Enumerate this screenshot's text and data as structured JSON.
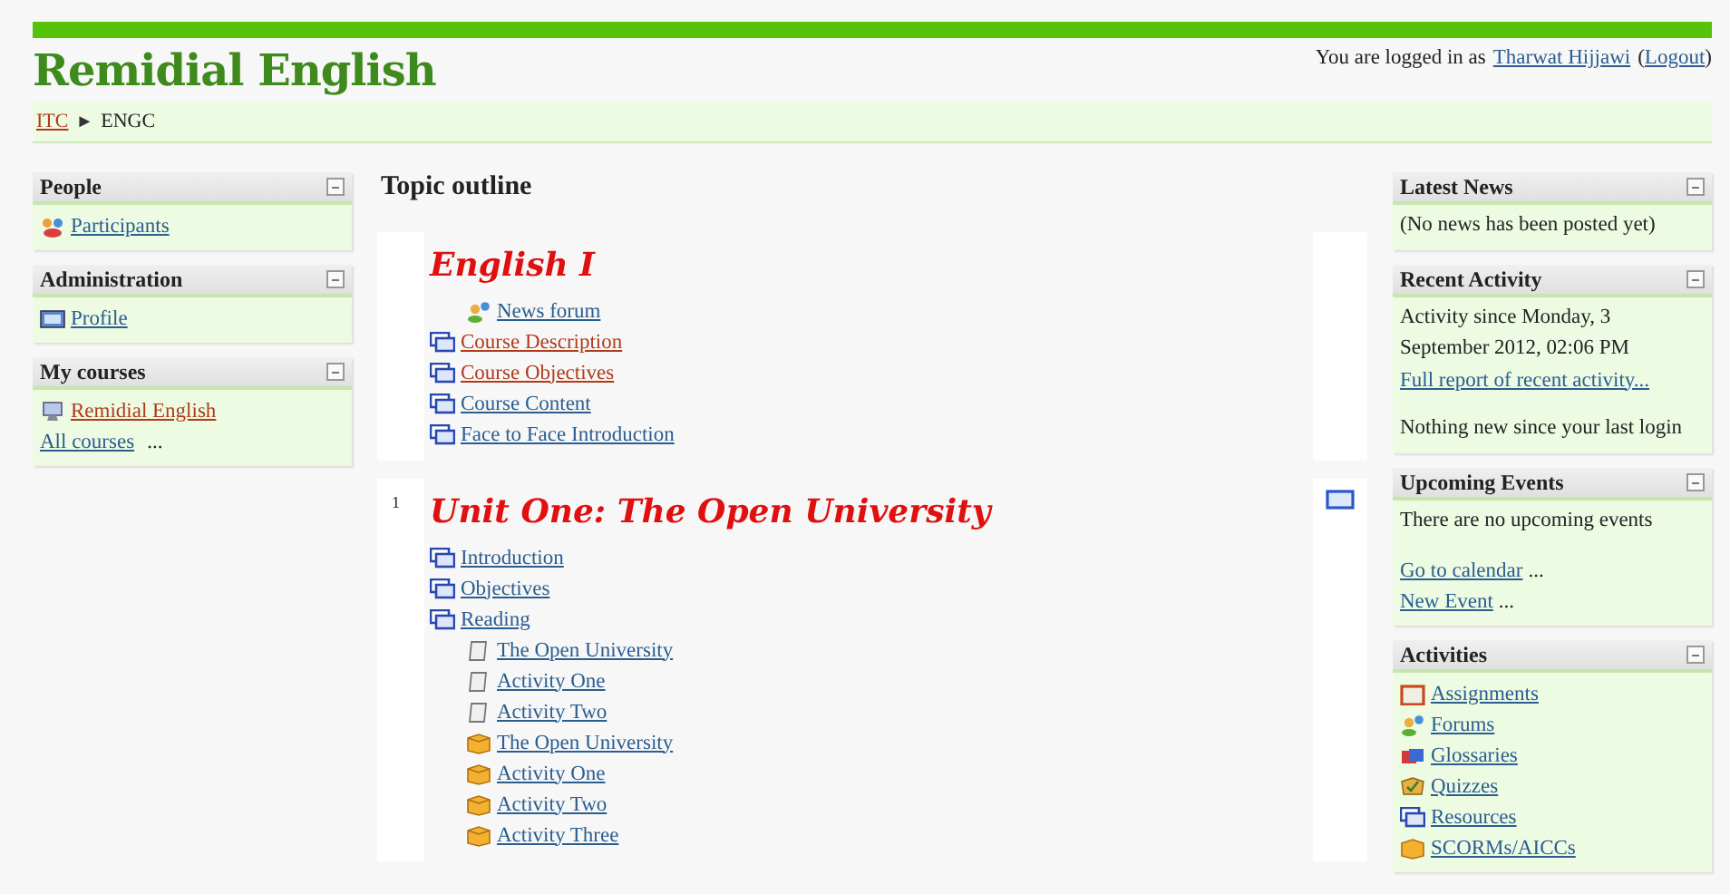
{
  "header": {
    "site_title": "Remidial English",
    "login": {
      "prefix": "You are logged in as",
      "user": "Tharwat Hijjawi",
      "open": "(",
      "logout": "Logout",
      "close": ")"
    }
  },
  "breadcrumb": {
    "separator": "►",
    "items": [
      {
        "label": "ITC",
        "kind": "link"
      },
      {
        "label": "ENGC",
        "kind": "text"
      }
    ]
  },
  "left_blocks": [
    {
      "title": "People",
      "items": [
        {
          "kind": "participants",
          "label": "Participants",
          "visited": false
        }
      ]
    },
    {
      "title": "Administration",
      "items": [
        {
          "kind": "profile",
          "label": "Profile",
          "visited": false
        }
      ]
    },
    {
      "title": "My courses",
      "items": [
        {
          "kind": "course",
          "label": "Remidial English",
          "visited": true
        },
        {
          "kind": "link",
          "label": "All courses",
          "suffix": "...",
          "visited": false
        }
      ]
    }
  ],
  "main": {
    "title": "Topic outline",
    "sections": [
      {
        "title": "English I",
        "highlight_toggle": false,
        "news_forum": {
          "label": "News forum",
          "visited": false
        },
        "items": [
          {
            "kind": "resource",
            "label": "Course Description",
            "visited": true
          },
          {
            "kind": "resource",
            "label": "Course Objectives",
            "visited": true
          },
          {
            "kind": "resource",
            "label": "Course Content",
            "visited": false
          },
          {
            "kind": "resource",
            "label": "Face to Face Introduction",
            "visited": false
          }
        ]
      },
      {
        "number": "1",
        "title": "Unit One: The Open University",
        "highlight_toggle": true,
        "items": [
          {
            "kind": "resource",
            "label": "Introduction",
            "visited": false
          },
          {
            "kind": "resource",
            "label": "Objectives",
            "visited": false
          },
          {
            "kind": "resource",
            "label": "Reading",
            "visited": false,
            "children": [
              {
                "kind": "page",
                "label": "The Open University",
                "visited": false
              },
              {
                "kind": "page",
                "label": "Activity One",
                "visited": false
              },
              {
                "kind": "page",
                "label": "Activity Two",
                "visited": false
              },
              {
                "kind": "scorm",
                "label": "The Open University",
                "visited": false
              },
              {
                "kind": "scorm",
                "label": "Activity One",
                "visited": false
              },
              {
                "kind": "scorm",
                "label": "Activity Two",
                "visited": false
              },
              {
                "kind": "scorm",
                "label": "Activity Three",
                "visited": false
              }
            ]
          }
        ]
      }
    ]
  },
  "right_blocks": [
    {
      "title": "Latest News",
      "items": [
        {
          "kind": "text",
          "text": "(No news has been posted yet)"
        }
      ]
    },
    {
      "title": "Recent Activity",
      "items": [
        {
          "kind": "text",
          "text": "Activity since Monday, 3 September 2012, 02:06 PM"
        },
        {
          "kind": "link",
          "label": "Full report of recent activity...",
          "visited": false
        },
        {
          "kind": "spacer"
        },
        {
          "kind": "text",
          "text": "Nothing new since your last login"
        }
      ]
    },
    {
      "title": "Upcoming Events",
      "items": [
        {
          "kind": "text",
          "text": "There are no upcoming events"
        },
        {
          "kind": "spacer"
        },
        {
          "kind": "link",
          "label": "Go to calendar",
          "suffix": "...",
          "visited": false
        },
        {
          "kind": "link",
          "label": "New Event",
          "suffix": "...",
          "visited": false
        }
      ]
    },
    {
      "title": "Activities",
      "items": [
        {
          "kind": "assignment",
          "label": "Assignments",
          "visited": false
        },
        {
          "kind": "forum",
          "label": "Forums",
          "visited": false
        },
        {
          "kind": "glossary",
          "label": "Glossaries",
          "visited": false
        },
        {
          "kind": "quiz",
          "label": "Quizzes",
          "visited": false
        },
        {
          "kind": "resource",
          "label": "Resources",
          "visited": false
        },
        {
          "kind": "scorm",
          "label": "SCORMs/AICCs",
          "visited": false
        }
      ]
    }
  ]
}
